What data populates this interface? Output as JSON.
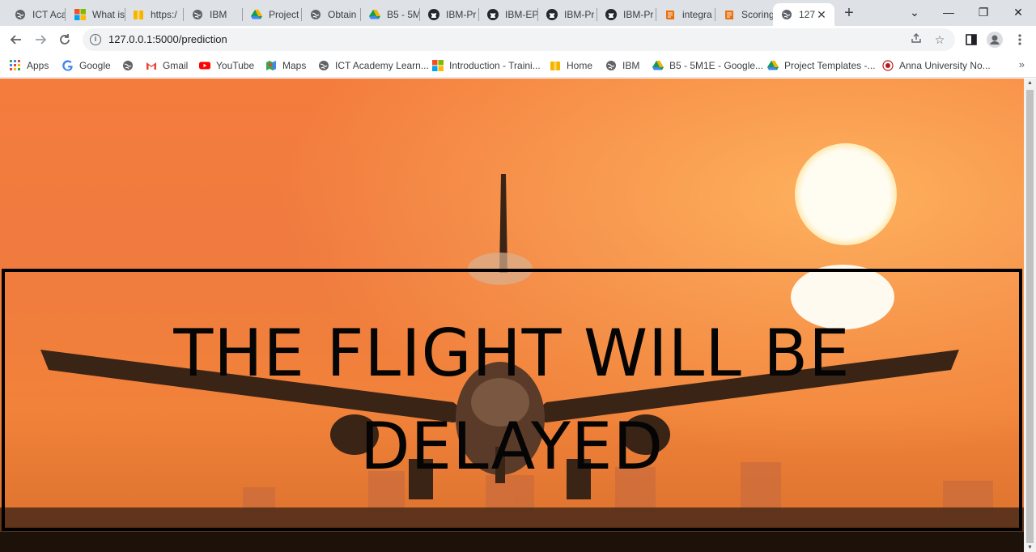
{
  "browser": {
    "tabs": [
      {
        "title": "ICT Aca",
        "icon": "globe"
      },
      {
        "title": "What is",
        "icon": "microsoft"
      },
      {
        "title": "https:/",
        "icon": "box"
      },
      {
        "title": "IBM",
        "icon": "globe"
      },
      {
        "title": "Project",
        "icon": "drive"
      },
      {
        "title": "Obtain",
        "icon": "globe"
      },
      {
        "title": "B5 - 5M",
        "icon": "drive"
      },
      {
        "title": "IBM-Pr",
        "icon": "github"
      },
      {
        "title": "IBM-EP",
        "icon": "github"
      },
      {
        "title": "IBM-Pr",
        "icon": "github"
      },
      {
        "title": "IBM-Pr",
        "icon": "github"
      },
      {
        "title": "integra",
        "icon": "notebook"
      },
      {
        "title": "Scoring",
        "icon": "notebook"
      },
      {
        "title": "127",
        "icon": "globe",
        "active": true
      }
    ],
    "new_tab_label": "+",
    "window_controls": {
      "dropdown": "⌄",
      "minimize": "—",
      "restore": "❐",
      "close": "✕"
    },
    "url": "127.0.0.1:5000/prediction",
    "bookmarks": [
      {
        "label": "Apps",
        "icon": "apps"
      },
      {
        "label": "Google",
        "icon": "google"
      },
      {
        "label": "",
        "icon": "globe"
      },
      {
        "label": "Gmail",
        "icon": "gmail"
      },
      {
        "label": "YouTube",
        "icon": "youtube"
      },
      {
        "label": "Maps",
        "icon": "maps"
      },
      {
        "label": "ICT Academy Learn...",
        "icon": "globe"
      },
      {
        "label": "Introduction - Traini...",
        "icon": "microsoft"
      },
      {
        "label": "Home",
        "icon": "box"
      },
      {
        "label": "IBM",
        "icon": "globe"
      },
      {
        "label": "B5 - 5M1E - Google...",
        "icon": "drive"
      },
      {
        "label": "Project Templates -...",
        "icon": "drive"
      },
      {
        "label": "Anna University No...",
        "icon": "seal"
      }
    ],
    "bookmarks_more": "»"
  },
  "page": {
    "result_message": "THE FLIGHT WILL BE DELAYED"
  },
  "colors": {
    "sky_top": "#f47a3c",
    "sky_bottom": "#f3862f",
    "sun": "#fffbe6",
    "text": "#050505"
  }
}
